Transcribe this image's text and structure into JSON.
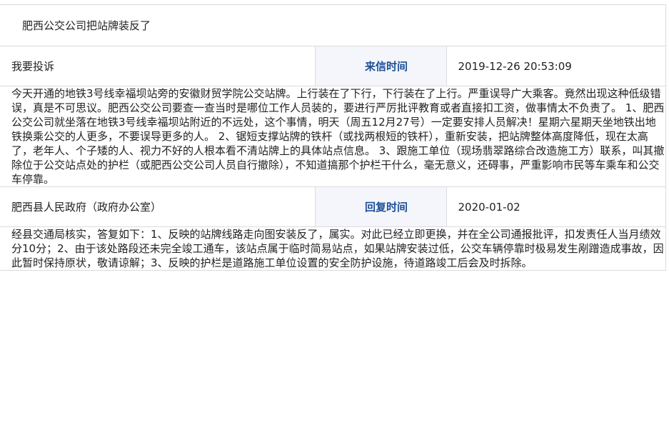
{
  "title": "肥西公交公司把站牌装反了",
  "letter": {
    "from": "我要投诉",
    "time_label": "来信时间",
    "time_value": "2019-12-26 20:53:09",
    "content": "今天开通的地铁3号线幸福坝站旁的安徽财贸学院公交站牌。上行装在了下行，下行装在了上行。严重误导广大乘客。竟然出现这种低级错误，真是不可思议。肥西公交公司要查一查当时是哪位工作人员装的，要进行严厉批评教育或者直接扣工资，做事情太不负责了。 1、肥西公交公司就坐落在地铁3号线幸福坝站附近的不远处，这个事情，明天（周五12月27号）一定要安排人员解决！星期六星期天坐地铁出地铁换乘公交的人更多，不要误导更多的人。 2、锯短支撑站牌的铁杆（或找两根短的铁杆），重新安装，把站牌整体高度降低，现在太高了，老年人、个子矮的人、视力不好的人根本看不清站牌上的具体站点信息。 3、跟施工单位（现场翡翠路综合改造施工方）联系，叫其撤除位于公交站点处的护栏（或肥西公交公司人员自行撤除），不知道搞那个护栏干什么，毫无意义，还碍事，严重影响市民等车乘车和公交车停靠。"
  },
  "reply": {
    "from": "肥西县人民政府（政府办公室）",
    "time_label": "回复时间",
    "time_value": "2020-01-02",
    "content": "经县交通局核实，答复如下：1、反映的站牌线路走向图安装反了，属实。对此已经立即更换，并在全公司通报批评，扣发责任人当月绩效分10分；2、由于该处路段还未完全竣工通车，该站点属于临时简易站点，如果站牌安装过低，公交车辆停靠时极易发生剐蹭造成事故，因此暂时保持原状，敬请谅解；3、反映的护栏是道路施工单位设置的安全防护设施，待道路竣工后会及时拆除。"
  },
  "colors": {
    "label_text": "#1d4f97",
    "label_background": "#f4f6fb",
    "border": "#dcdcdc"
  }
}
